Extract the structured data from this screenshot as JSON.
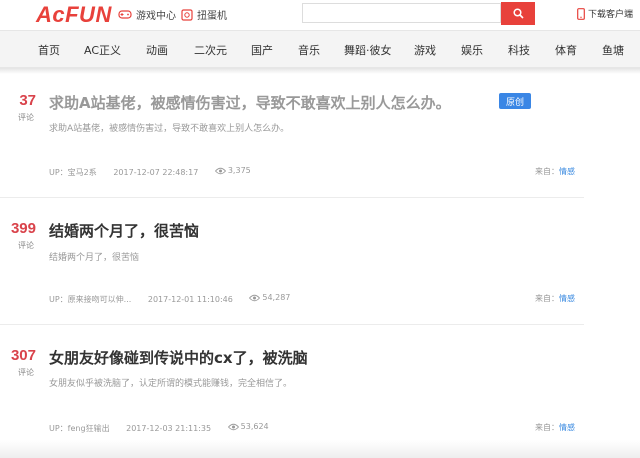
{
  "header": {
    "logo": "AcFUN",
    "game_center": "游戏中心",
    "gacha": "扭蛋机",
    "search_placeholder": "",
    "download": "下载客户端"
  },
  "nav": {
    "items": [
      "首页",
      "AC正义",
      "动画",
      "二次元",
      "国产",
      "音乐",
      "舞蹈·彼女",
      "游戏",
      "娱乐",
      "科技",
      "体育",
      "鱼塘"
    ]
  },
  "posts": [
    {
      "count": "37",
      "count_label": "评论",
      "title": "求助A站基佬，被感情伤害过，导致不敢喜欢上别人怎么办。",
      "description": "求助A站基佬，被感情伤害过，导致不敢喜欢上别人怎么办。",
      "badge": "原创",
      "uploader": "UP：宝马2系",
      "datetime": "2017-12-07  22:48:17",
      "views": "3,375",
      "from_label": "来自：",
      "channel": "情感"
    },
    {
      "count": "399",
      "count_label": "评论",
      "title": "结婚两个月了，很苦恼",
      "description": "结婚两个月了，很苦恼",
      "uploader": "UP：原来接吻可以伸...",
      "datetime": "2017-12-01  11:10:46",
      "views": "54,287",
      "from_label": "来自：",
      "channel": "情感"
    },
    {
      "count": "307",
      "count_label": "评论",
      "title": "女朋友好像碰到传说中的cx了，被洗脑",
      "description": "女朋友似乎被洗脑了，认定所谓的模式能赚钱，完全相信了。",
      "uploader": "UP：feng狂输出",
      "datetime": "2017-12-03  21:11:35",
      "views": "53,624",
      "from_label": "来自：",
      "channel": "情感"
    }
  ],
  "colors": {
    "brand": "#e8413b",
    "count": "#d9434b",
    "link": "#3a8ae0",
    "badge": "#3a86e5"
  }
}
